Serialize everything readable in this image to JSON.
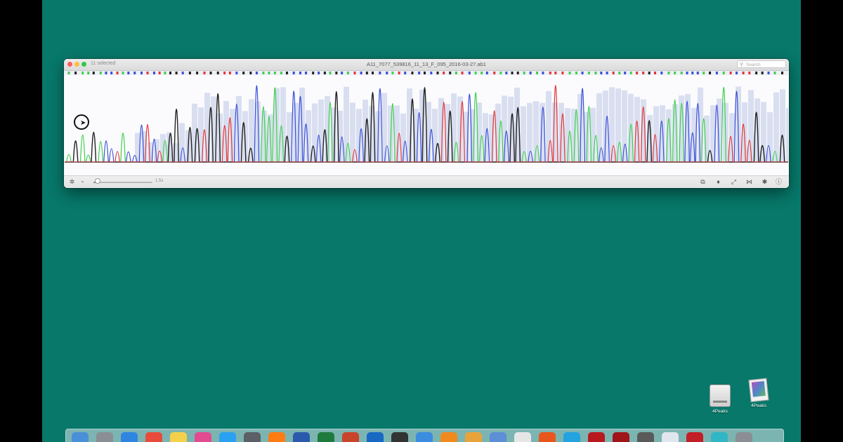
{
  "window": {
    "selected_label": "11 selected",
    "file_title": "A11_7077_539816_11_13_F_095_2016-03-27.ab1",
    "search_placeholder": "Search"
  },
  "toolbar": {
    "settings_icon": "gear-icon",
    "zoom_value_label": "1.5x",
    "zoom_fraction": 0.05,
    "right_icons": [
      "copy-icon",
      "microphone-icon",
      "expand-icon",
      "trim-icon",
      "settings-icon",
      "info-icon"
    ]
  },
  "colors": {
    "desktop": "#07786a",
    "trace_A": "#3fd04f",
    "trace_C": "#3a4fd8",
    "trace_G": "#222222",
    "trace_T": "#e33535",
    "quality_bar": "#d9dff0"
  },
  "desktop_icons": [
    {
      "name": "drive",
      "label": "4Peaks",
      "icon": "hard-drive-icon"
    },
    {
      "name": "app",
      "label": "4Peaks",
      "icon": "photo-icon"
    }
  ],
  "dock": {
    "apps": [
      "finder-icon",
      "launchpad-icon",
      "safari-icon",
      "calendar-icon",
      "notes-icon",
      "itunes-icon",
      "appstore-icon",
      "syspref-icon",
      "illustrator-icon",
      "word-icon",
      "excel-icon",
      "powerpoint-icon",
      "outlook-icon",
      "terminal-icon",
      "mail-icon",
      "vlc-icon",
      "pages-icon",
      "preview-icon",
      "chrome-icon",
      "firefox-icon",
      "skype-icon",
      "adobe-icon",
      "acrobat-icon",
      "quicktime-icon",
      "photos-icon",
      "reader-icon",
      "circle-app-icon",
      "trash-icon"
    ]
  }
}
